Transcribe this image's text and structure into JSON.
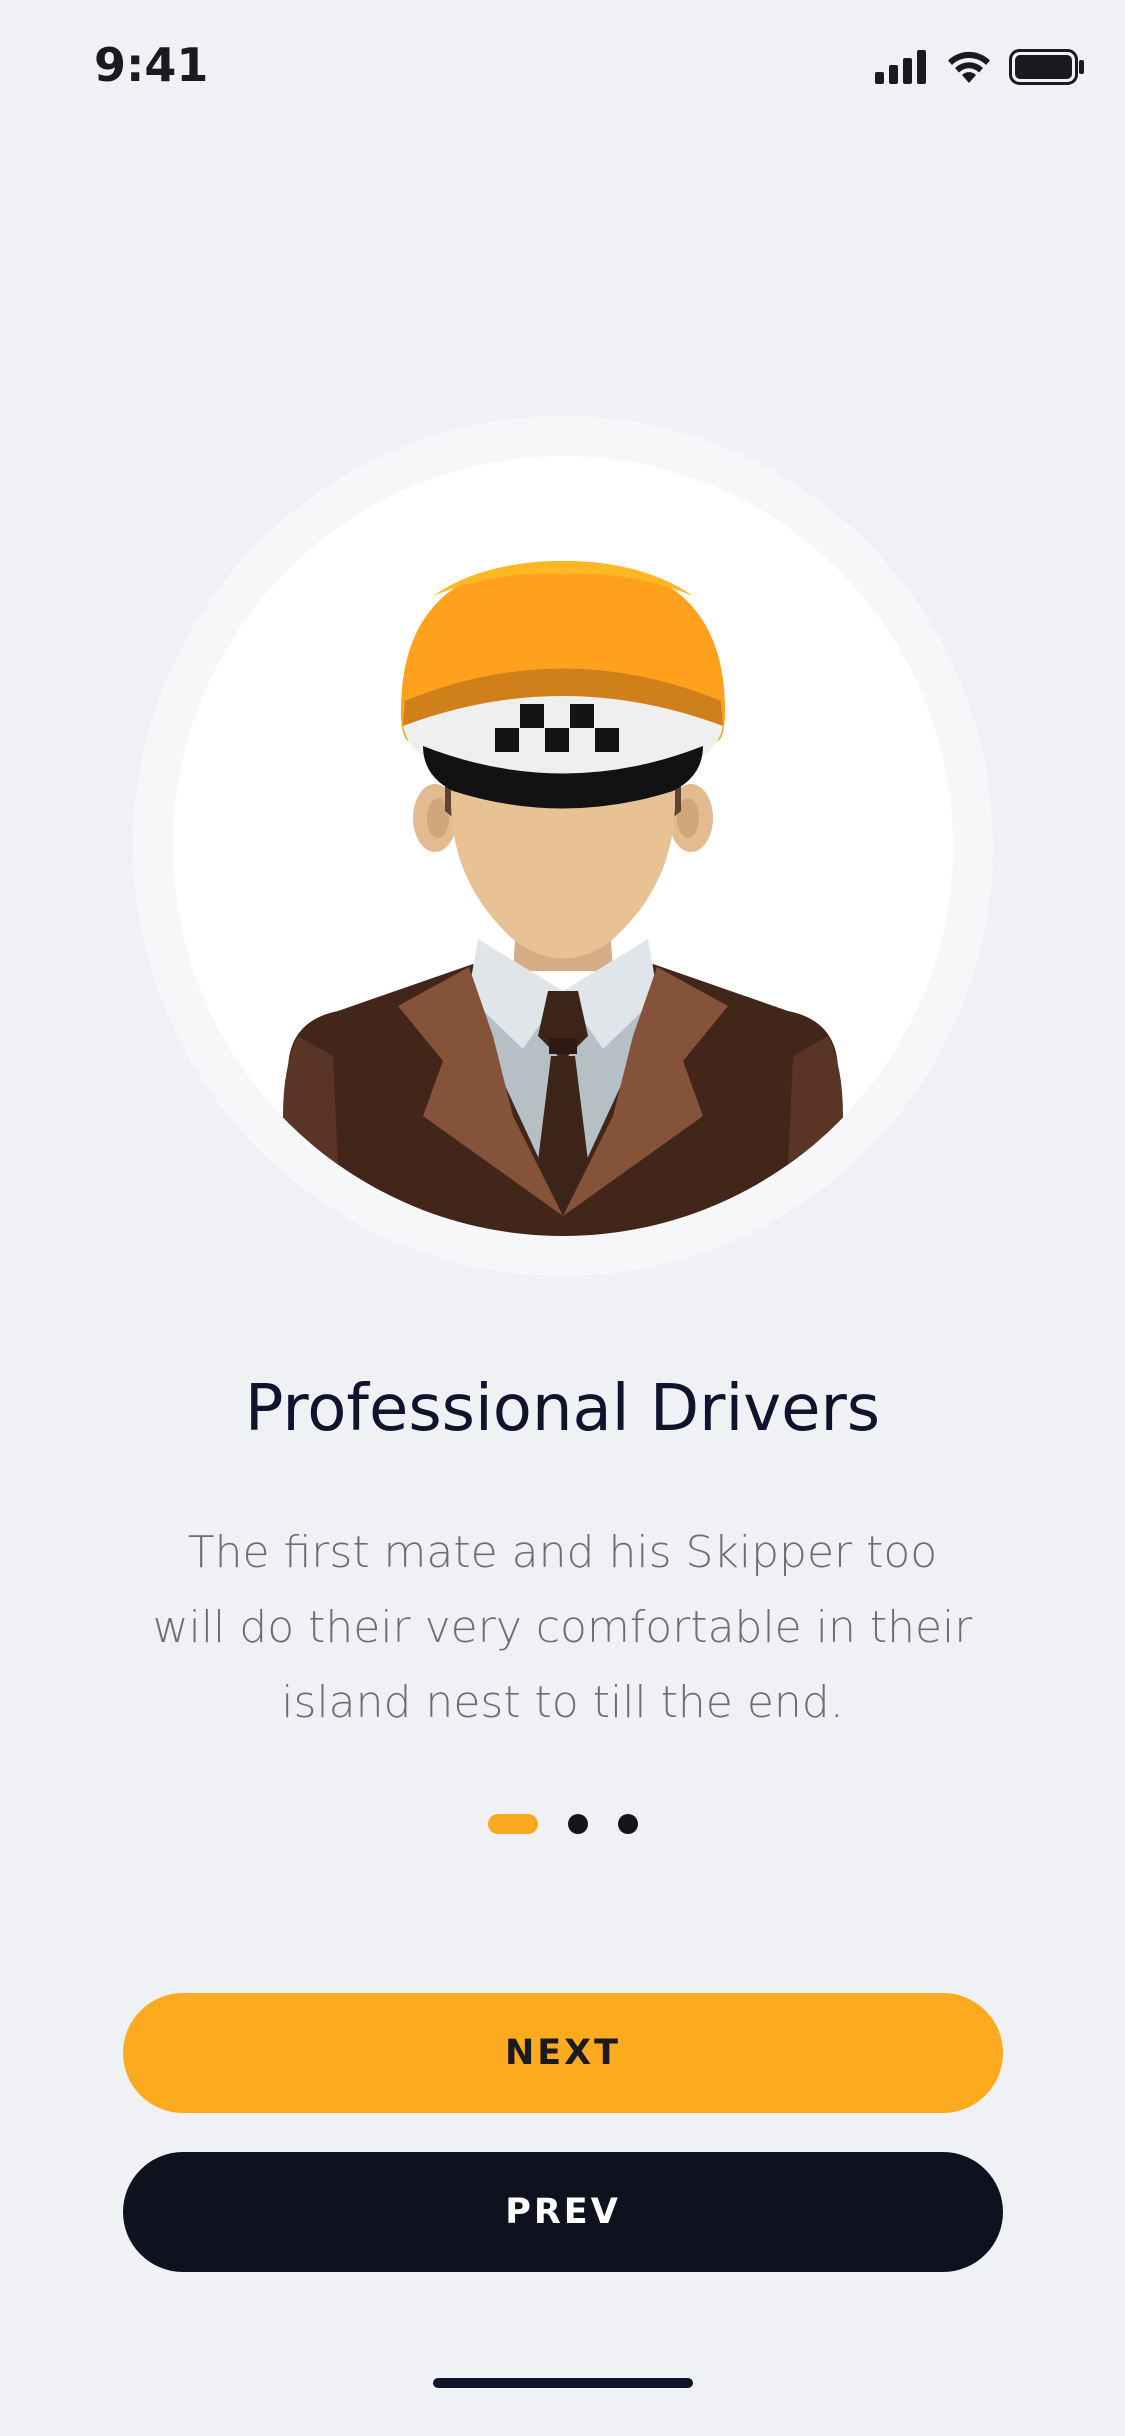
{
  "status_bar": {
    "time": "9:41",
    "icons": [
      "cellular-signal-icon",
      "wifi-icon",
      "battery-icon"
    ]
  },
  "illustration": {
    "subject": "taxi-driver-avatar"
  },
  "onboarding": {
    "title": "Professional Drivers",
    "description": "The first mate and his Skipper too will do their very comfortable in their island nest to till the end.",
    "pagination": {
      "total": 3,
      "active_index": 0
    }
  },
  "buttons": {
    "next_label": "NEXT",
    "prev_label": "PREV"
  },
  "colors": {
    "accent": "#FCAA1E",
    "dark": "#10111F",
    "background": "#F0F1F5"
  }
}
